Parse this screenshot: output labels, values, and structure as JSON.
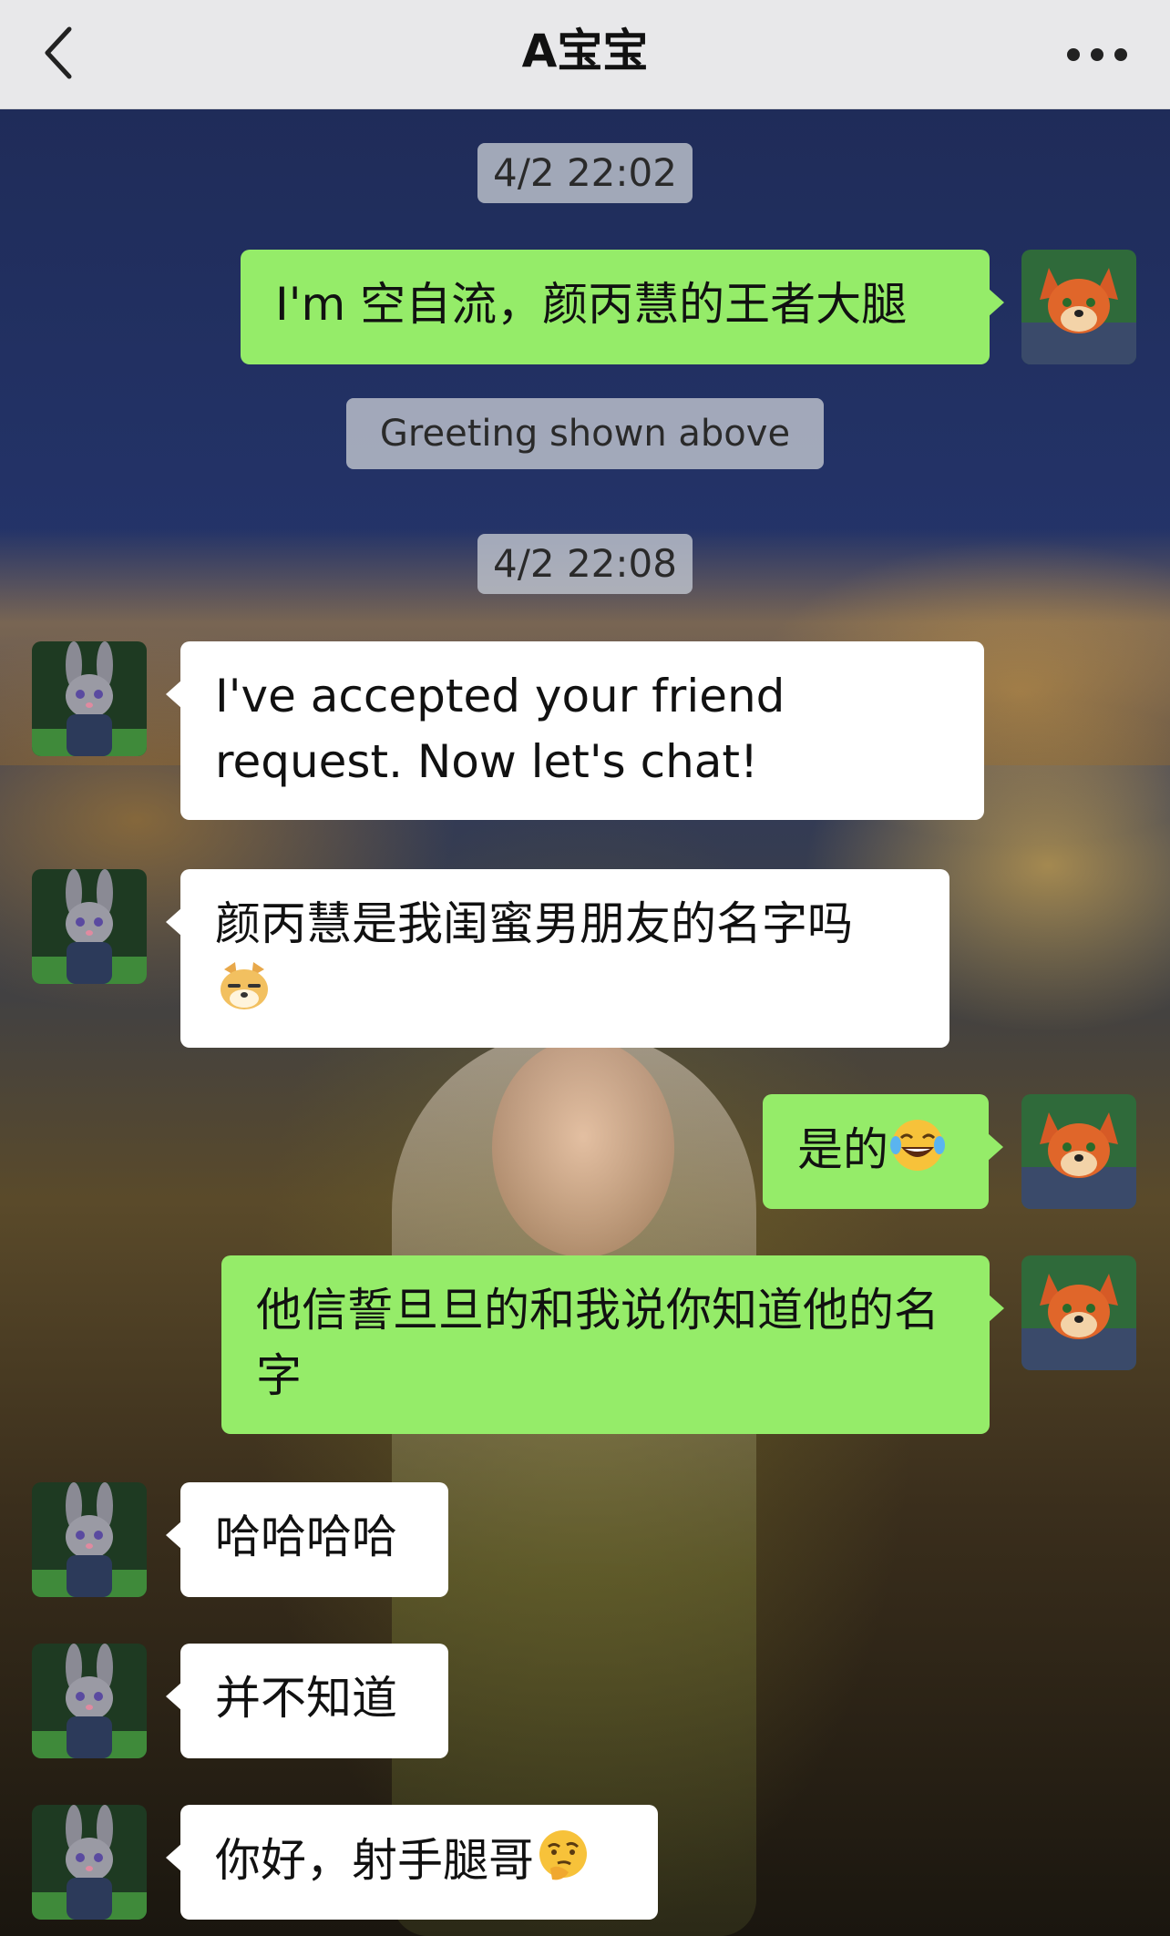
{
  "header": {
    "title": "A宝宝",
    "back_icon": "chevron-left-icon",
    "more_icon": "more-dots-icon",
    "background": "#e8e8ea"
  },
  "colors": {
    "self_bubble": "#95ec69",
    "other_bubble": "#ffffff",
    "pill": "#bec3cd"
  },
  "chat": {
    "timestamp_1": "4/2 22:02",
    "timestamp_2": "4/2 22:08",
    "system_message": "Greeting shown above",
    "messages": [
      {
        "sender": "self",
        "text": "I'm 空自流，颜丙慧的王者大腿"
      },
      {
        "sender": "other",
        "text": "I've accepted your friend request. Now let's chat!"
      },
      {
        "sender": "other",
        "text": "颜丙慧是我闺蜜男朋友的名字吗",
        "emoji": "doge-emoji-icon"
      },
      {
        "sender": "self",
        "text": "是的",
        "emoji": "tears-of-joy-emoji-icon"
      },
      {
        "sender": "self",
        "text": "他信誓旦旦的和我说你知道他的名字"
      },
      {
        "sender": "other",
        "text": "哈哈哈哈"
      },
      {
        "sender": "other",
        "text": "并不知道"
      },
      {
        "sender": "other",
        "text": "你好，射手腿哥",
        "emoji": "thinking-emoji-icon"
      }
    ],
    "self_avatar": "fox-avatar-icon",
    "other_avatar": "rabbit-avatar-icon"
  }
}
